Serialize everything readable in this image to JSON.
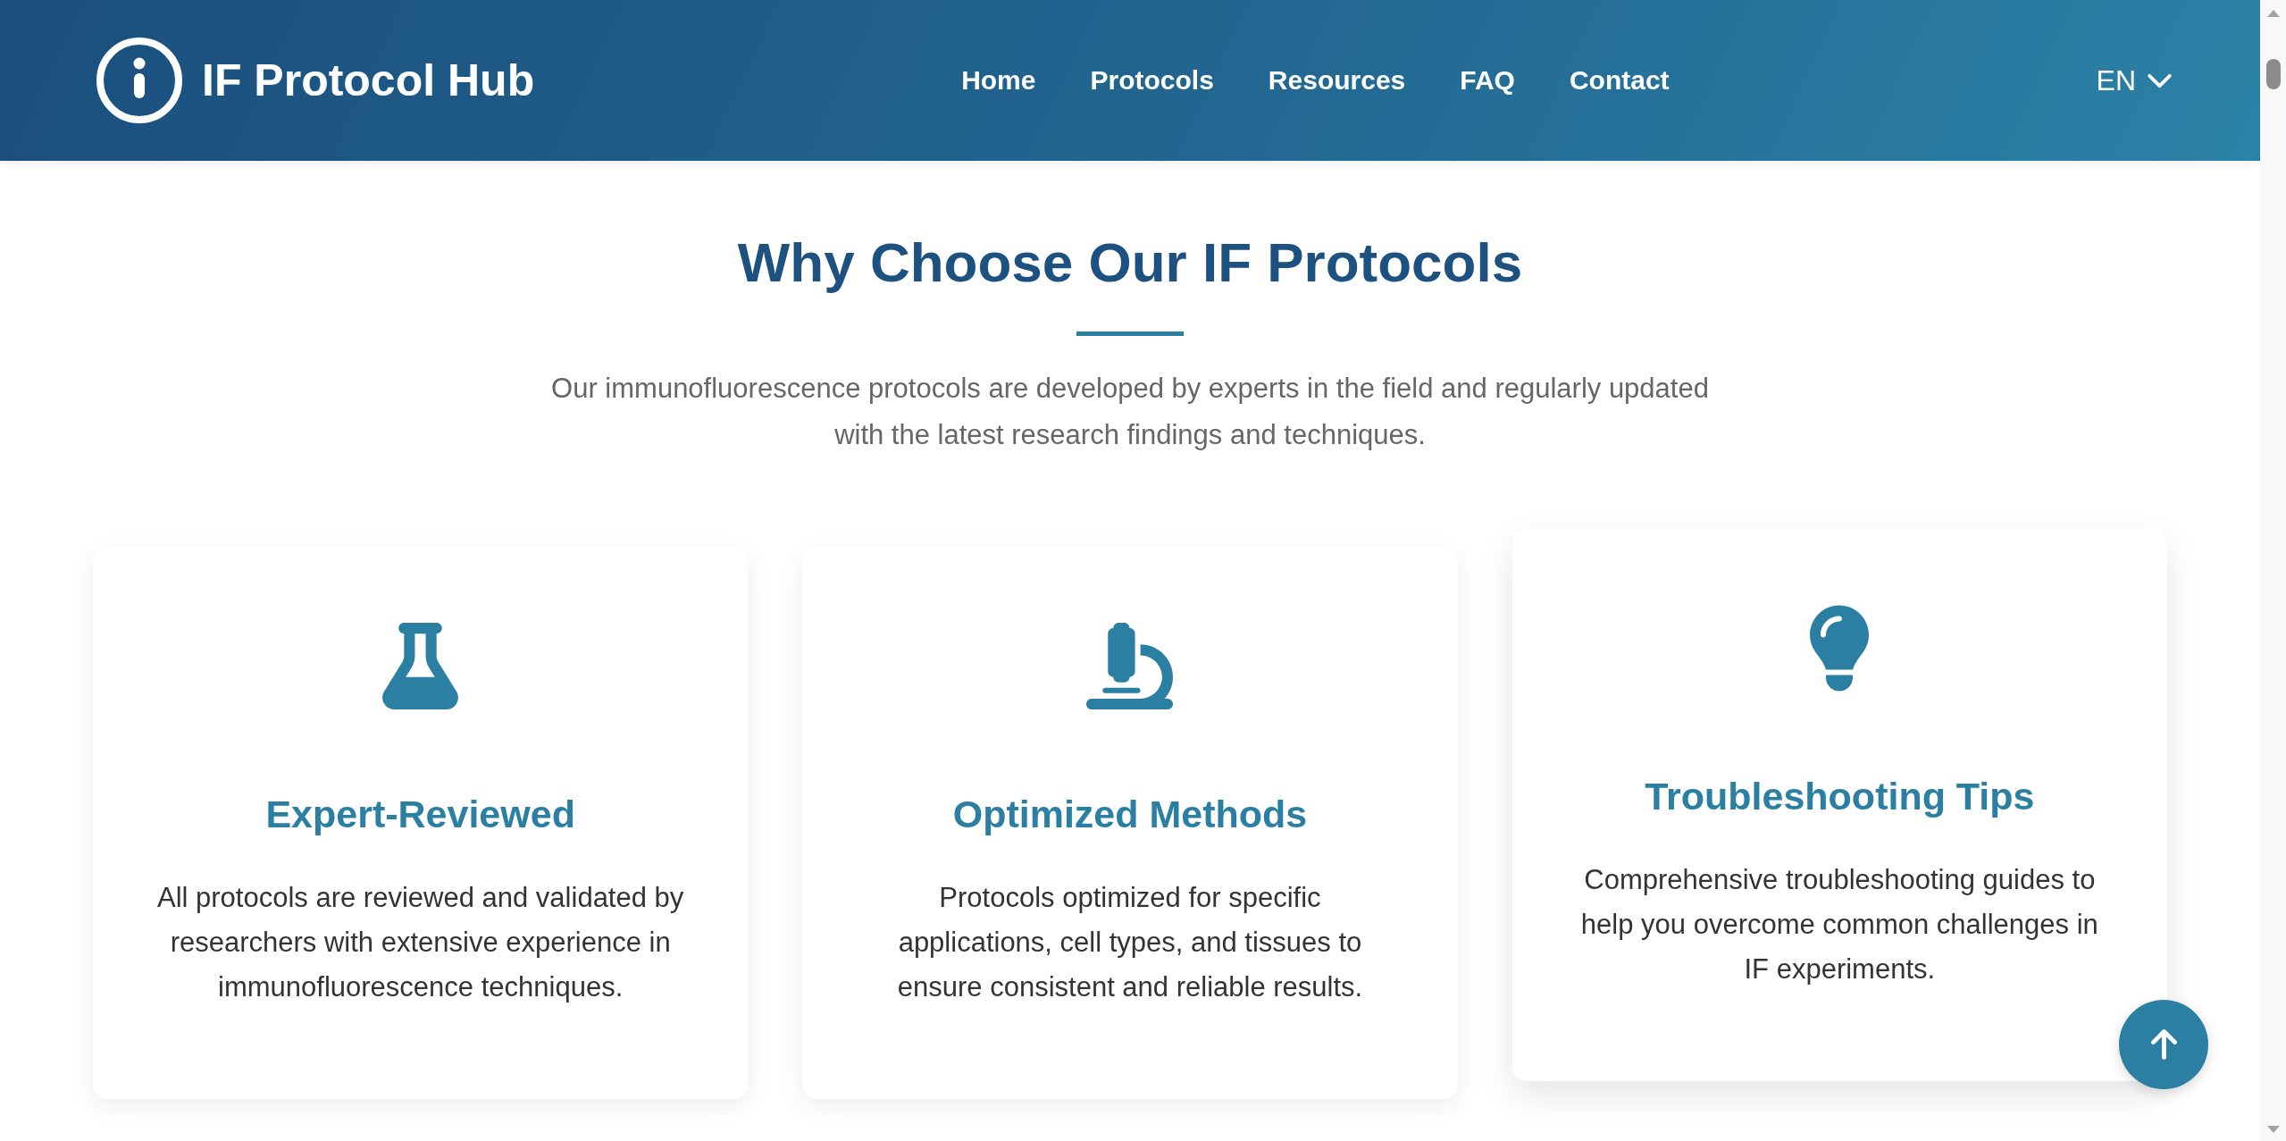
{
  "header": {
    "logo": {
      "text": "IF Protocol Hub"
    },
    "nav_links": [
      {
        "label": "Home"
      },
      {
        "label": "Protocols"
      },
      {
        "label": "Resources"
      },
      {
        "label": "FAQ"
      },
      {
        "label": "Contact"
      }
    ],
    "language": {
      "label": "EN"
    }
  },
  "intro": {
    "title": "Why Choose Our IF Protocols",
    "subtitle": "Our immunofluorescence protocols are developed by experts in the field and regularly updated with the latest research findings and techniques."
  },
  "features": [
    {
      "title": "Expert-Reviewed",
      "text": "All protocols are reviewed and validated by researchers with extensive experience in immunofluorescence techniques.",
      "hovered": false
    },
    {
      "title": "Optimized Methods",
      "text": "Protocols optimized for specific applications, cell types, and tissues to ensure consistent and reliable results.",
      "hovered": false
    },
    {
      "title": "Troubleshooting Tips",
      "text": "Comprehensive troubleshooting guides to help you overcome common challenges in IF experiments.",
      "hovered": true
    }
  ],
  "back_to_top": {
    "shown": true
  }
}
